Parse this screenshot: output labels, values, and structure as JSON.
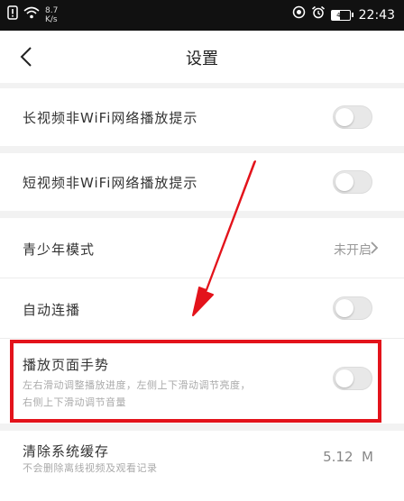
{
  "status_bar": {
    "speed_value": "8.7",
    "speed_unit": "K/s",
    "battery_level": "45",
    "time": "22:43"
  },
  "header": {
    "title": "设置"
  },
  "settings": {
    "long_video_wifi": {
      "label": "长视频非WiFi网络播放提示",
      "enabled": false
    },
    "short_video_wifi": {
      "label": "短视频非WiFi网络播放提示",
      "enabled": false
    },
    "teen_mode": {
      "label": "青少年模式",
      "value": "未开启"
    },
    "autoplay": {
      "label": "自动连播",
      "enabled": false
    },
    "playback_gesture": {
      "label": "播放页面手势",
      "description_line1": "左右滑动调整播放进度，左侧上下滑动调节亮度，",
      "description_line2": "右侧上下滑动调节音量",
      "enabled": false
    },
    "clear_cache": {
      "label": "清除系统缓存",
      "description": "不会删除离线视频及观看记录",
      "value": "5.12  M"
    }
  },
  "colors": {
    "highlight": "#e3131b",
    "background": "#f2f2f2"
  }
}
